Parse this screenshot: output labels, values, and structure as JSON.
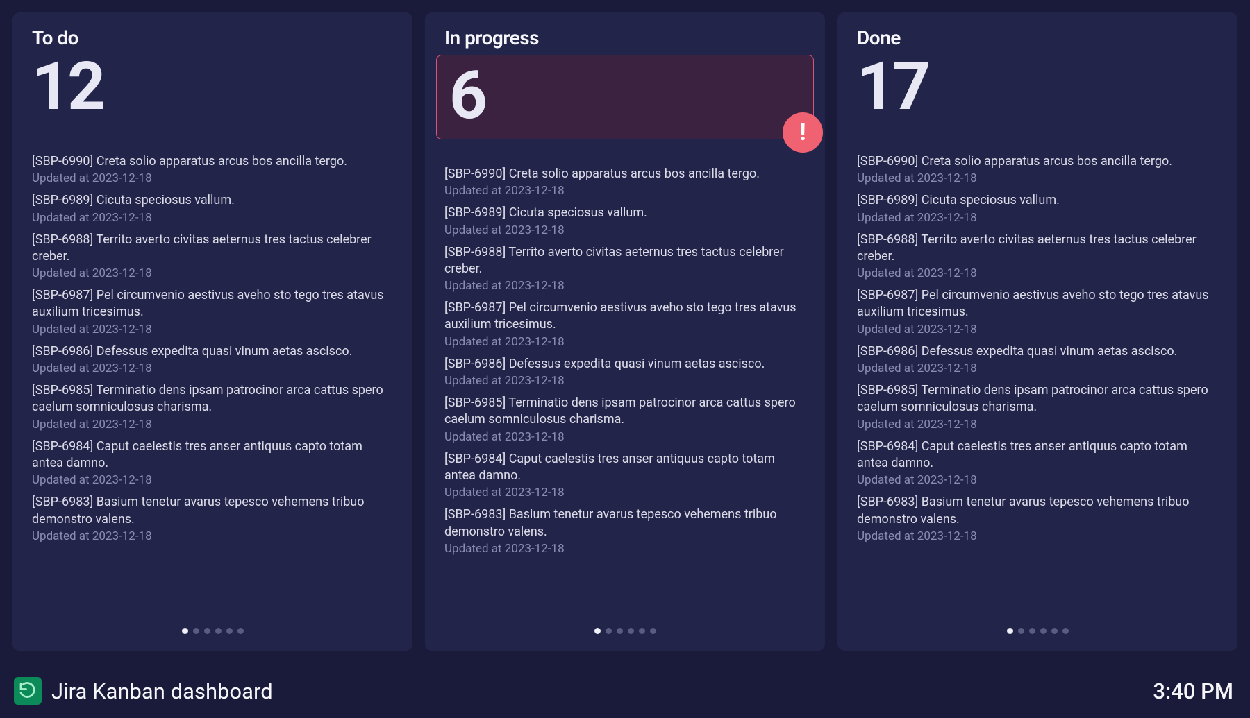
{
  "footer": {
    "title": "Jira Kanban dashboard",
    "time": "3:40 PM"
  },
  "columns": [
    {
      "id": "todo",
      "title": "To do",
      "count": "12",
      "alert": false,
      "pager_total": 6,
      "pager_active": 0
    },
    {
      "id": "inprogress",
      "title": "In progress",
      "count": "6",
      "alert": true,
      "pager_total": 6,
      "pager_active": 0
    },
    {
      "id": "done",
      "title": "Done",
      "count": "17",
      "alert": false,
      "pager_total": 6,
      "pager_active": 0
    }
  ],
  "tickets": [
    {
      "title": "[SBP-6990] Creta solio apparatus arcus bos ancilla tergo.",
      "updated": "Updated at 2023-12-18"
    },
    {
      "title": "[SBP-6989] Cicuta speciosus vallum.",
      "updated": "Updated at 2023-12-18"
    },
    {
      "title": "[SBP-6988] Territo averto civitas aeternus tres tactus celebrer creber.",
      "updated": "Updated at 2023-12-18"
    },
    {
      "title": "[SBP-6987] Pel circumvenio aestivus aveho sto tego tres atavus auxilium tricesimus.",
      "updated": "Updated at 2023-12-18"
    },
    {
      "title": "[SBP-6986] Defessus expedita quasi vinum aetas ascisco.",
      "updated": "Updated at 2023-12-18"
    },
    {
      "title": "[SBP-6985] Terminatio dens ipsam patrocinor arca cattus spero caelum somniculosus charisma.",
      "updated": "Updated at 2023-12-18"
    },
    {
      "title": "[SBP-6984] Caput caelestis tres anser antiquus capto totam antea damno.",
      "updated": "Updated at 2023-12-18"
    },
    {
      "title": "[SBP-6983] Basium tenetur avarus tepesco vehemens tribuo demonstro valens.",
      "updated": "Updated at 2023-12-18"
    }
  ]
}
